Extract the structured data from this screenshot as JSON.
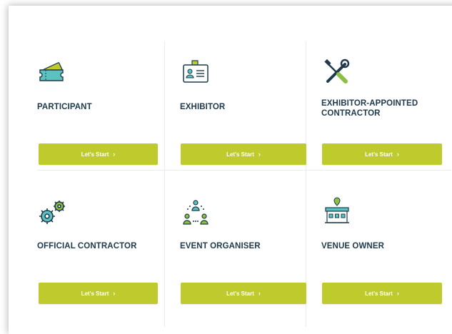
{
  "roles": [
    {
      "title": "PARTICIPANT",
      "icon": "ticket-icon",
      "button": "Let's Start",
      "chevron": "›"
    },
    {
      "title": "EXHIBITOR",
      "icon": "id-badge-icon",
      "button": "Let's Start",
      "chevron": "›"
    },
    {
      "title": "EXHIBITOR-APPOINTED CONTRACTOR",
      "icon": "tools-icon",
      "button": "Let's Start",
      "chevron": "›"
    },
    {
      "title": "OFFICIAL CONTRACTOR",
      "icon": "gears-icon",
      "button": "Let's Start",
      "chevron": "›"
    },
    {
      "title": "EVENT ORGANISER",
      "icon": "people-network-icon",
      "button": "Let's Start",
      "chevron": "›"
    },
    {
      "title": "VENUE OWNER",
      "icon": "venue-building-icon",
      "button": "Let's Start",
      "chevron": "›"
    }
  ],
  "colors": {
    "button_bg": "#bfcb2d",
    "title_text": "#1e3a4c",
    "icon_teal": "#5bc2c0",
    "icon_green": "#8dbf45",
    "icon_navy": "#1e3a4c"
  }
}
